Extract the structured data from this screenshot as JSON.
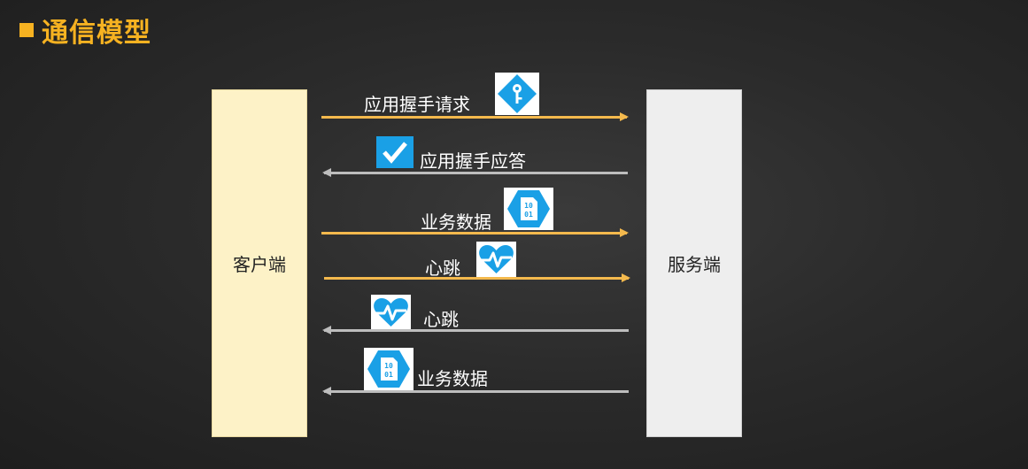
{
  "title": "通信模型",
  "client": {
    "label": "客户端"
  },
  "server": {
    "label": "服务端"
  },
  "messages": [
    {
      "label": "应用握手请求",
      "direction": "client-to-server",
      "icon": "key-icon"
    },
    {
      "label": "应用握手应答",
      "direction": "server-to-client",
      "icon": "checkmark-icon"
    },
    {
      "label": "业务数据",
      "direction": "client-to-server",
      "icon": "binary-data-icon"
    },
    {
      "label": "心跳",
      "direction": "client-to-server",
      "icon": "heartbeat-icon"
    },
    {
      "label": "心跳",
      "direction": "server-to-client",
      "icon": "heartbeat-icon"
    },
    {
      "label": "业务数据",
      "direction": "server-to-client",
      "icon": "binary-data-icon"
    }
  ],
  "colors": {
    "title": "#f6b221",
    "client_box": "#fdf2c7",
    "server_box": "#eeeeee",
    "arrow_to_server": "#f4b94d",
    "arrow_to_client": "#bdbdbd",
    "icon_blue": "#1aa0e6"
  }
}
